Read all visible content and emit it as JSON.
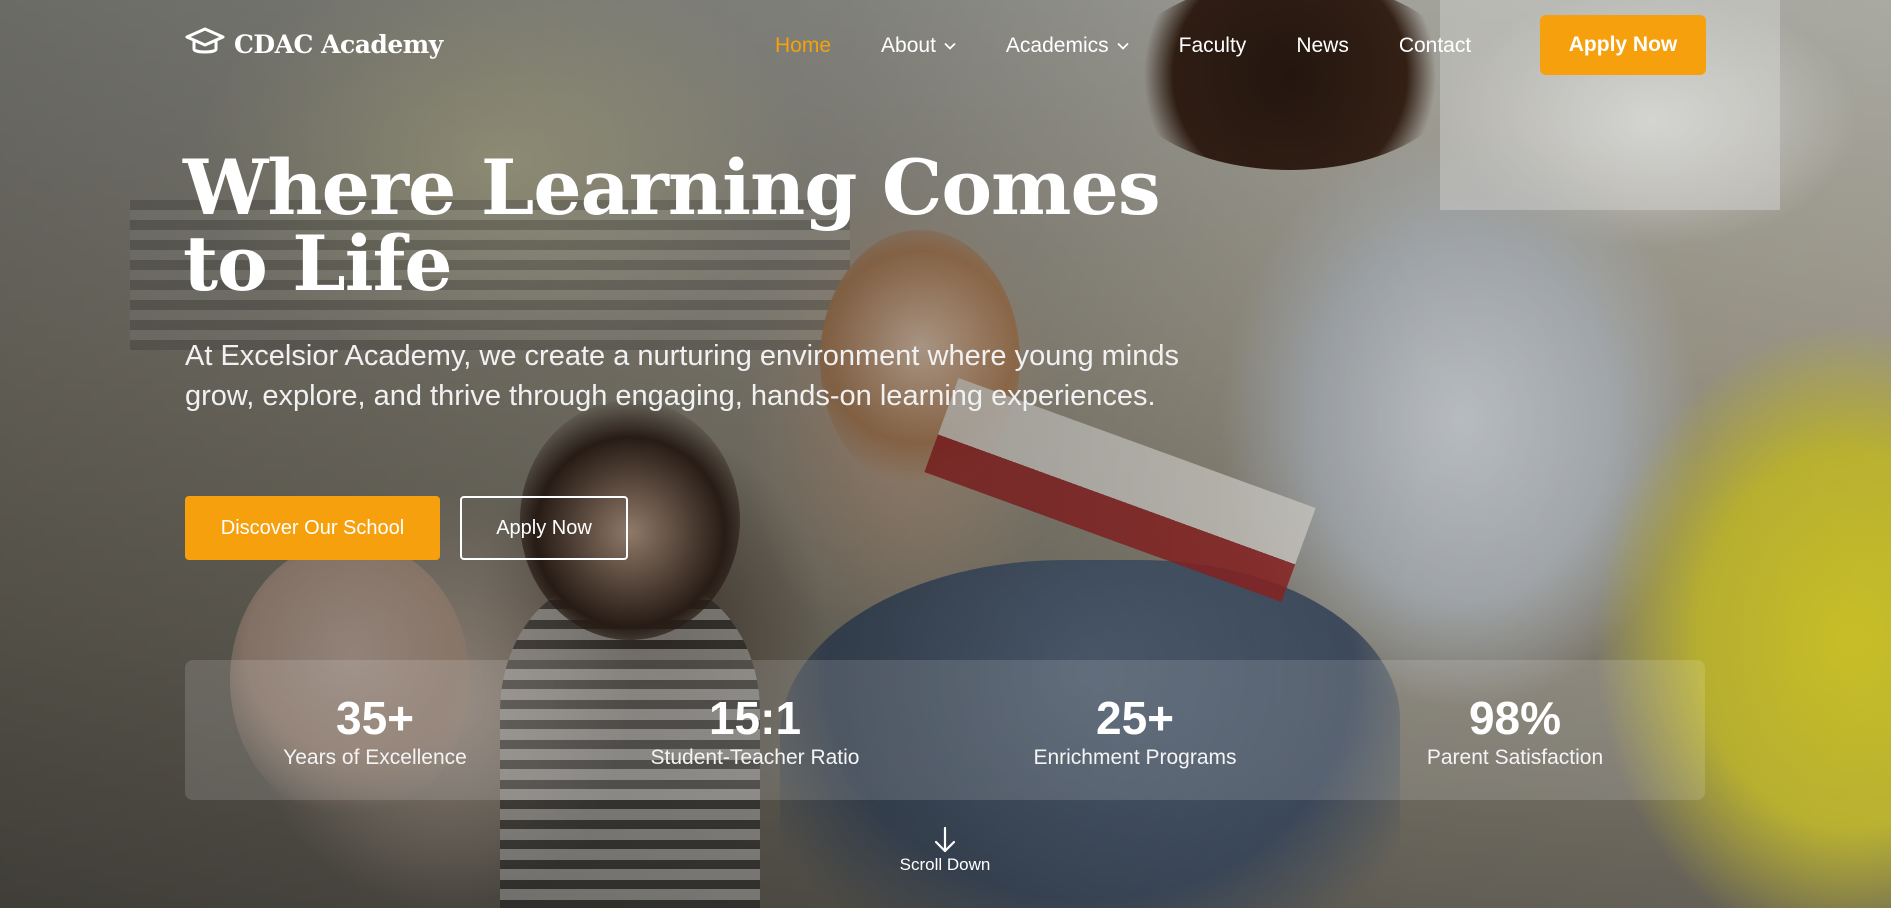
{
  "brand": {
    "name": "CDAC Academy",
    "icon": "graduation-cap-icon"
  },
  "nav": {
    "items": [
      {
        "label": "Home",
        "active": true,
        "has_dropdown": false
      },
      {
        "label": "About",
        "active": false,
        "has_dropdown": true
      },
      {
        "label": "Academics",
        "active": false,
        "has_dropdown": true
      },
      {
        "label": "Faculty",
        "active": false,
        "has_dropdown": false
      },
      {
        "label": "News",
        "active": false,
        "has_dropdown": false
      },
      {
        "label": "Contact",
        "active": false,
        "has_dropdown": false
      }
    ],
    "apply_label": "Apply Now"
  },
  "hero": {
    "title": "Where Learning Comes to Life",
    "subtitle": "At Excelsior Academy, we create a nurturing environment where young minds grow, explore, and thrive through engaging, hands-on learning experiences.",
    "primary_cta": "Discover Our School",
    "secondary_cta": "Apply Now"
  },
  "stats": [
    {
      "value": "35+",
      "label": "Years of Excellence"
    },
    {
      "value": "15:1",
      "label": "Student-Teacher Ratio"
    },
    {
      "value": "25+",
      "label": "Enrichment Programs"
    },
    {
      "value": "98%",
      "label": "Parent Satisfaction"
    }
  ],
  "scroll": {
    "label": "Scroll Down",
    "icon": "arrow-down-icon"
  },
  "colors": {
    "accent": "#f5a00c",
    "active_nav": "#f5a20a",
    "text": "#ffffff"
  }
}
